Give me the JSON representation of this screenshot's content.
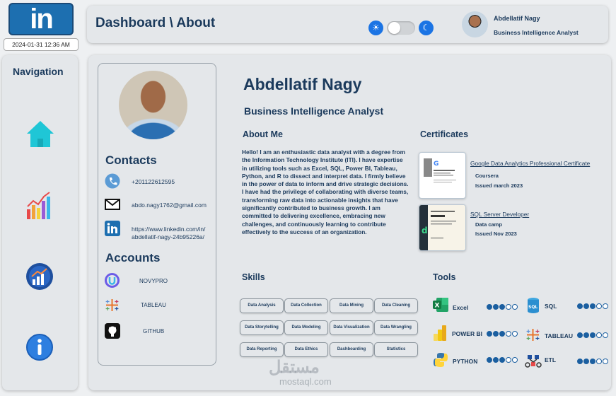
{
  "app": {
    "logo_text": "in",
    "datetime": "2024-01-31 12:36 AM"
  },
  "header": {
    "title": "Dashboard \\ About",
    "user_name": "Abdellatif Nagy",
    "user_role": "Business Intelligence Analyst",
    "theme": "light"
  },
  "nav": {
    "title": "Navigation",
    "items": [
      {
        "icon": "home-icon"
      },
      {
        "icon": "bar-chart-icon"
      },
      {
        "icon": "growth-chart-icon"
      },
      {
        "icon": "info-icon"
      }
    ]
  },
  "profile": {
    "contacts_title": "Contacts",
    "phone": "+201122612595",
    "email": "abdo.nagy1762@gmail.com",
    "linkedin": "https://www.linkedin.com/in/abdellatif-nagy-24b95226a/",
    "linkedin_line1": "https://www.linkedin.com/in/",
    "linkedin_line2": "abdellatif-nagy-24b95226a/",
    "accounts_title": "Accounts",
    "accounts": [
      {
        "label": "NOVYPRO",
        "icon": "novypro-icon"
      },
      {
        "label": "TABLEAU",
        "icon": "tableau-icon"
      },
      {
        "label": "GITHUB",
        "icon": "github-icon"
      }
    ]
  },
  "about": {
    "name": "Abdellatif Nagy",
    "role": "Business Intelligence Analyst",
    "title": "About Me",
    "text": "Hello! I am an enthusiastic data analyst with a degree from the Information Technology Institute (ITI). I have expertise in utilizing tools such as Excel, SQL, Power BI, Tableau, Python, and R to dissect and interpret data. I firmly believe in the power of data to inform and drive strategic decisions. I have had the privilege of collaborating with diverse teams, transforming raw data into actionable insights that have significantly contributed to business growth. I am committed to delivering excellence, embracing new challenges, and continuously learning to contribute effectively to the success of an organization."
  },
  "certificates": {
    "title": "Certificates",
    "items": [
      {
        "name": "Google Data Analytics Professional Certificate",
        "issuer": "Coursera",
        "issued": "Issued march 2023"
      },
      {
        "name": "SQL Server Developer",
        "issuer": "Data camp",
        "issued": "Issued Nov 2023"
      }
    ]
  },
  "skills": {
    "title": "Skills",
    "items": [
      "Data Analysis",
      "Data Collection",
      "Data Mining",
      "Data Cleaning",
      "Data Storytelling",
      "Data Modeling",
      "Data Visualization",
      "Data Wrangling",
      "Data Reporting",
      "Data Ethics",
      "Dashboarding",
      "Statistics"
    ]
  },
  "tools": {
    "title": "Tools",
    "items": [
      {
        "name": "Excel",
        "icon": "excel-icon",
        "level": 3,
        "max": 5
      },
      {
        "name": "SQL",
        "icon": "sql-icon",
        "level": 3,
        "max": 5
      },
      {
        "name": "POWER BI",
        "icon": "powerbi-icon",
        "level": 3,
        "max": 5
      },
      {
        "name": "TABLEAU",
        "icon": "tableau-icon",
        "level": 3,
        "max": 5
      },
      {
        "name": "PYTHON",
        "icon": "python-icon",
        "level": 3,
        "max": 5
      },
      {
        "name": "ETL",
        "icon": "etl-icon",
        "level": 3,
        "max": 5
      }
    ]
  },
  "watermark": {
    "arabic": "مستقل",
    "latin": "mostaql.com"
  },
  "colors": {
    "primary": "#1b3a5c",
    "accent": "#1b74e4",
    "panel": "#e4e7ea",
    "linkedin": "#1d6fb0"
  }
}
